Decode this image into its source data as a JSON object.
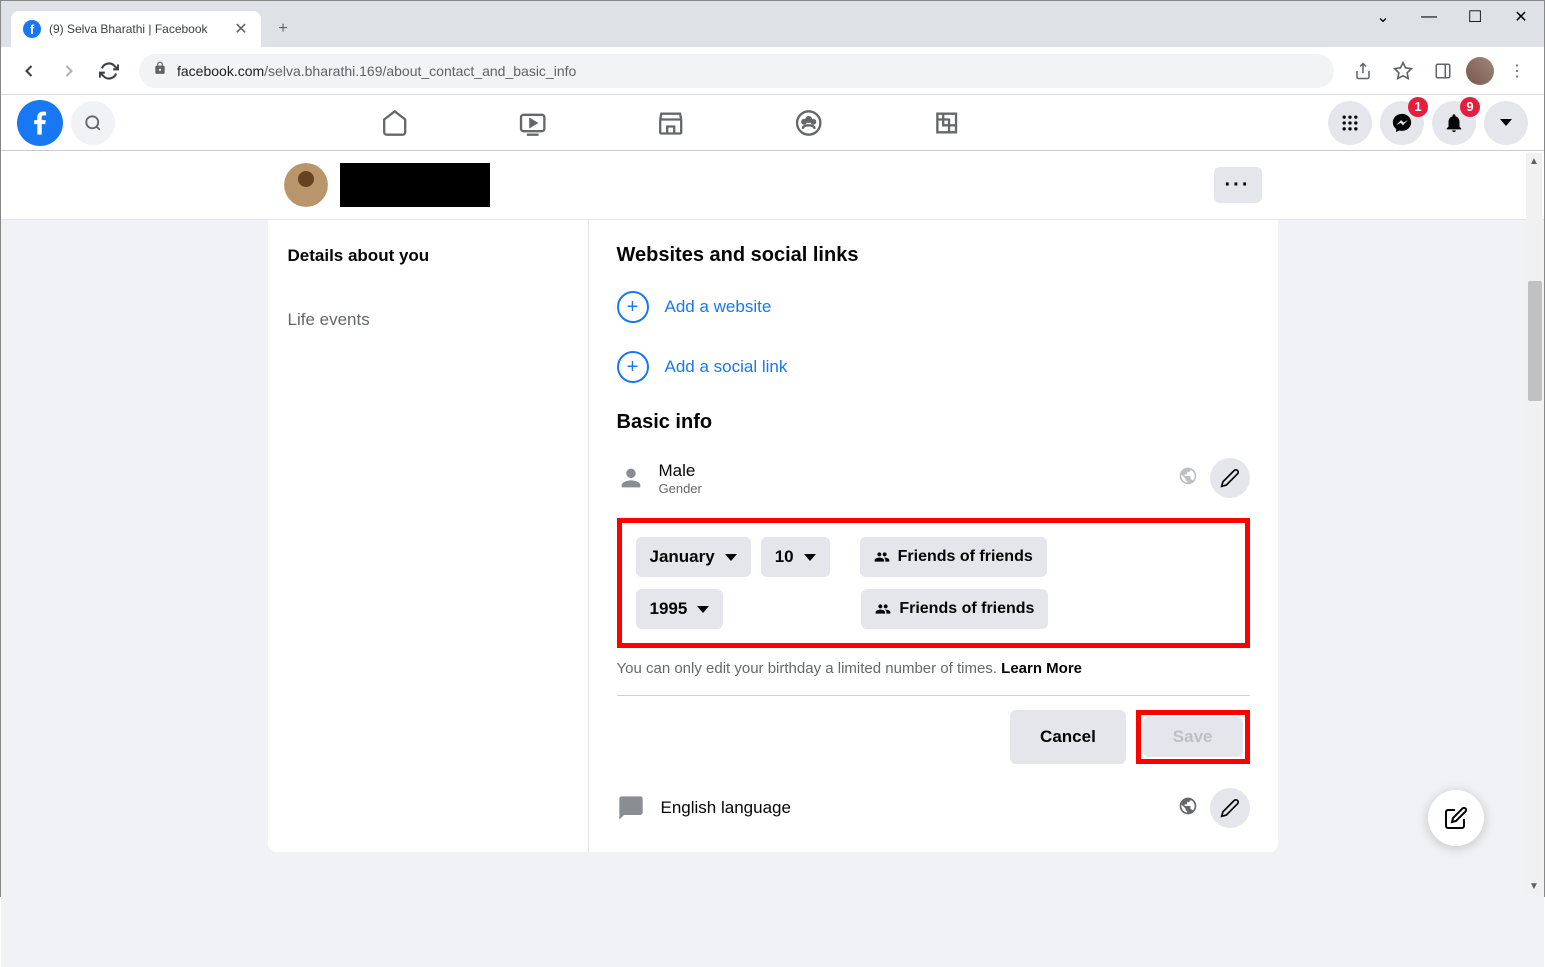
{
  "browser": {
    "tab_title": "(9) Selva Bharathi | Facebook",
    "url_domain": "facebook.com",
    "url_path": "/selva.bharathi.169/about_contact_and_basic_info"
  },
  "fb_header": {
    "messenger_badge": "1",
    "notifications_badge": "9"
  },
  "sidebar": {
    "details": "Details about you",
    "life_events": "Life events"
  },
  "sections": {
    "websites_title": "Websites and social links",
    "add_website": "Add a website",
    "add_social": "Add a social link",
    "basic_info_title": "Basic info"
  },
  "gender": {
    "value": "Male",
    "label": "Gender"
  },
  "birthday": {
    "month": "January",
    "day": "10",
    "year": "1995",
    "privacy_md": "Friends of friends",
    "privacy_y": "Friends of friends",
    "hint": "You can only edit your birthday a limited number of times. ",
    "learn_more": "Learn More"
  },
  "buttons": {
    "cancel": "Cancel",
    "save": "Save"
  },
  "language": {
    "value": "English language"
  }
}
